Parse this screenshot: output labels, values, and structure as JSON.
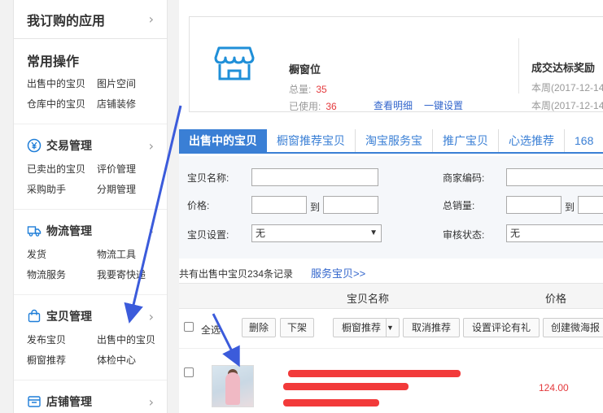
{
  "sidebar": {
    "subscribed_apps": "我订购的应用",
    "common": {
      "title": "常用操作",
      "links": [
        "出售中的宝贝",
        "图片空间",
        "仓库中的宝贝",
        "店铺装修"
      ]
    },
    "trade": {
      "title": "交易管理",
      "links": [
        "已卖出的宝贝",
        "评价管理",
        "采购助手",
        "分期管理"
      ]
    },
    "logistics": {
      "title": "物流管理",
      "links": [
        "发货",
        "物流工具",
        "物流服务",
        "我要寄快递"
      ]
    },
    "goods": {
      "title": "宝贝管理",
      "links": [
        "发布宝贝",
        "出售中的宝贝",
        "橱窗推荐",
        "体检中心"
      ]
    },
    "shop": {
      "title": "店铺管理"
    }
  },
  "banner": {
    "title": "橱窗位",
    "total_label": "总量:",
    "total_value": "35",
    "used_label": "已使用:",
    "used_value": "36",
    "detail_link": "查看明细",
    "setting_link": "一键设置",
    "reward_title": "成交达标奖励",
    "week_row_1": "本周(2017-12-14",
    "week_row_2": "本周(2017-12-14"
  },
  "tabs": [
    "出售中的宝贝",
    "橱窗推荐宝贝",
    "淘宝服务宝",
    "推广宝贝",
    "心选推荐",
    "168"
  ],
  "filters": {
    "name_label": "宝贝名称:",
    "merchant_code_label": "商家编码:",
    "price_label": "价格:",
    "to_1": "到",
    "total_sales_label": "总销量:",
    "to_2": "到",
    "setting_label": "宝贝设置:",
    "setting_value": "无",
    "review_label": "审核状态:",
    "review_value": "无"
  },
  "list": {
    "count_text": "共有出售中宝贝234条记录",
    "service_link": "服务宝贝>>",
    "col_name": "宝贝名称",
    "col_price": "价格"
  },
  "toolbar": {
    "select_all": "全选",
    "delete": "删除",
    "unlist": "下架",
    "window_recommend": "橱窗推荐",
    "cancel_recommend": "取消推荐",
    "review_gift": "设置评论有礼",
    "weitao_poster": "创建微海报"
  },
  "item": {
    "price": "124.00"
  },
  "colors": {
    "accent": "#3a7fd5",
    "price": "#e4393c",
    "annotation": "#3b5bdb"
  }
}
